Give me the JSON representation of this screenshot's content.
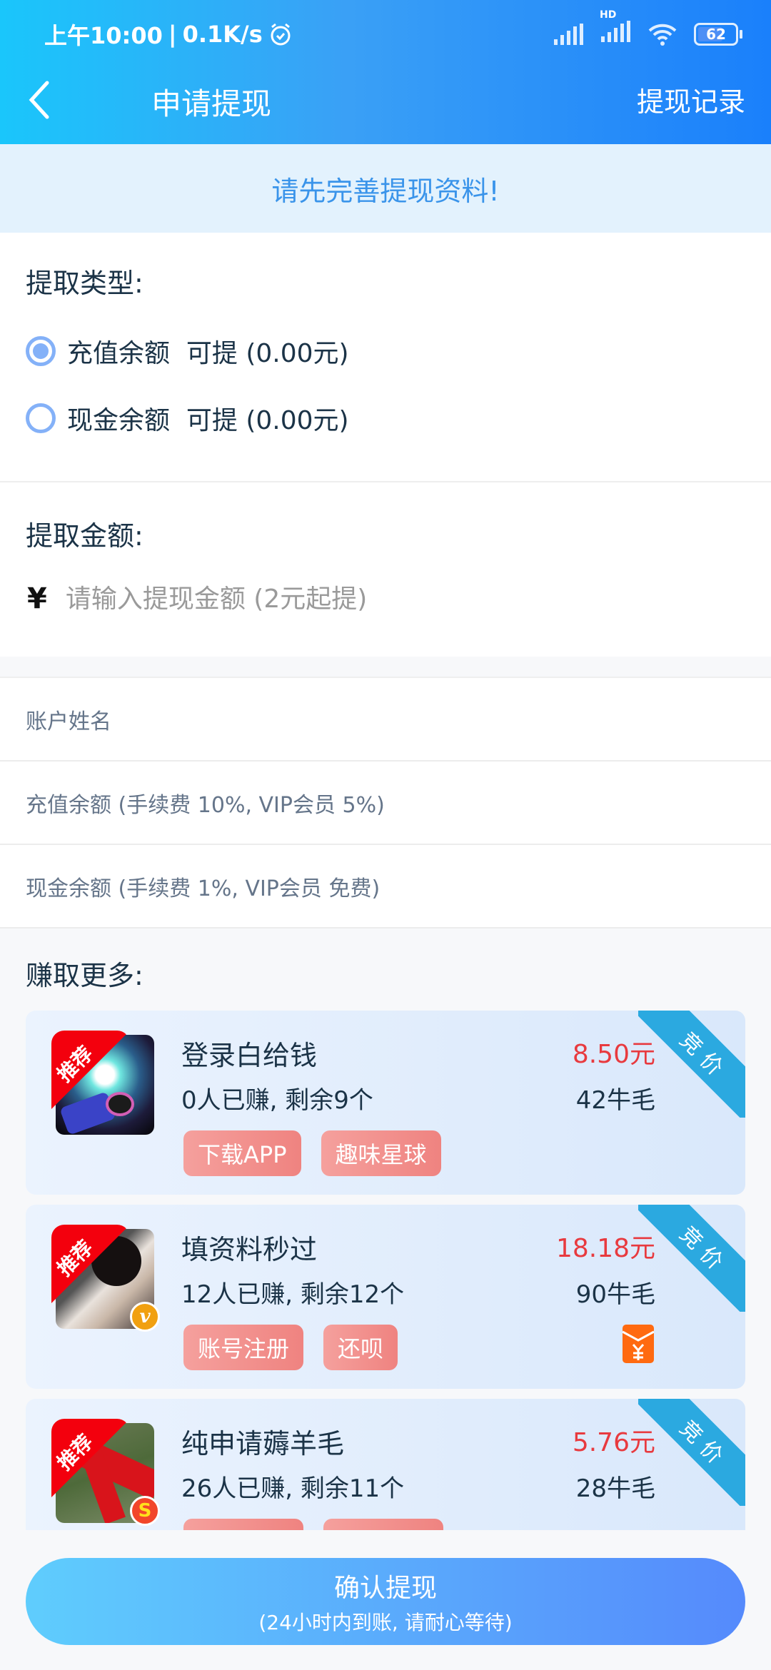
{
  "status_bar": {
    "time": "上午10:00",
    "speed": "0.1K/s",
    "signal_label": "HD",
    "battery": "62"
  },
  "header": {
    "title": "申请提现",
    "right_link": "提现记录"
  },
  "notice": "请先完善提现资料!",
  "withdraw_type": {
    "label": "提取类型:",
    "options": [
      {
        "label": "充值余额  可提 (0.00元)",
        "selected": true
      },
      {
        "label": "现金余额  可提 (0.00元)",
        "selected": false
      }
    ]
  },
  "amount": {
    "label": "提取金额:",
    "currency": "¥",
    "value": "",
    "placeholder": "请输入提现金额 (2元起提)"
  },
  "fields": [
    {
      "placeholder": "账户姓名"
    },
    {
      "placeholder": "充值余额 (手续费 10%, VIP会员 5%)"
    },
    {
      "placeholder": "现金余额 (手续费 1%, VIP会员 免费)"
    }
  ],
  "earn_more": {
    "title": "赚取更多:",
    "recommend_label": "推荐",
    "ribbon_label": "竞价",
    "tasks": [
      {
        "title": "登录白给钱",
        "stats": "0人已赚, 剩余9个",
        "price": "8.50元",
        "points": "42牛毛",
        "tags": [
          "下载APP",
          "趣味星球"
        ],
        "badge": "",
        "has_red_envelope": false
      },
      {
        "title": "填资料秒过",
        "stats": "12人已赚, 剩余12个",
        "price": "18.18元",
        "points": "90牛毛",
        "tags": [
          "账号注册",
          "还呗"
        ],
        "badge": "v",
        "has_red_envelope": true
      },
      {
        "title": "纯申请薅羊毛",
        "stats": "26人已赚, 剩余11个",
        "price": "5.76元",
        "points": "28牛毛",
        "tags": [
          "",
          ""
        ],
        "badge": "S",
        "has_red_envelope": false
      }
    ]
  },
  "confirm_button": {
    "label": "确认提现",
    "sublabel": "(24小时内到账, 请耐心等待)"
  },
  "colors": {
    "accent": "#3a94ea",
    "price": "#e83a3f",
    "ribbon": "#2ba9e0",
    "tag": "#ef8380"
  }
}
